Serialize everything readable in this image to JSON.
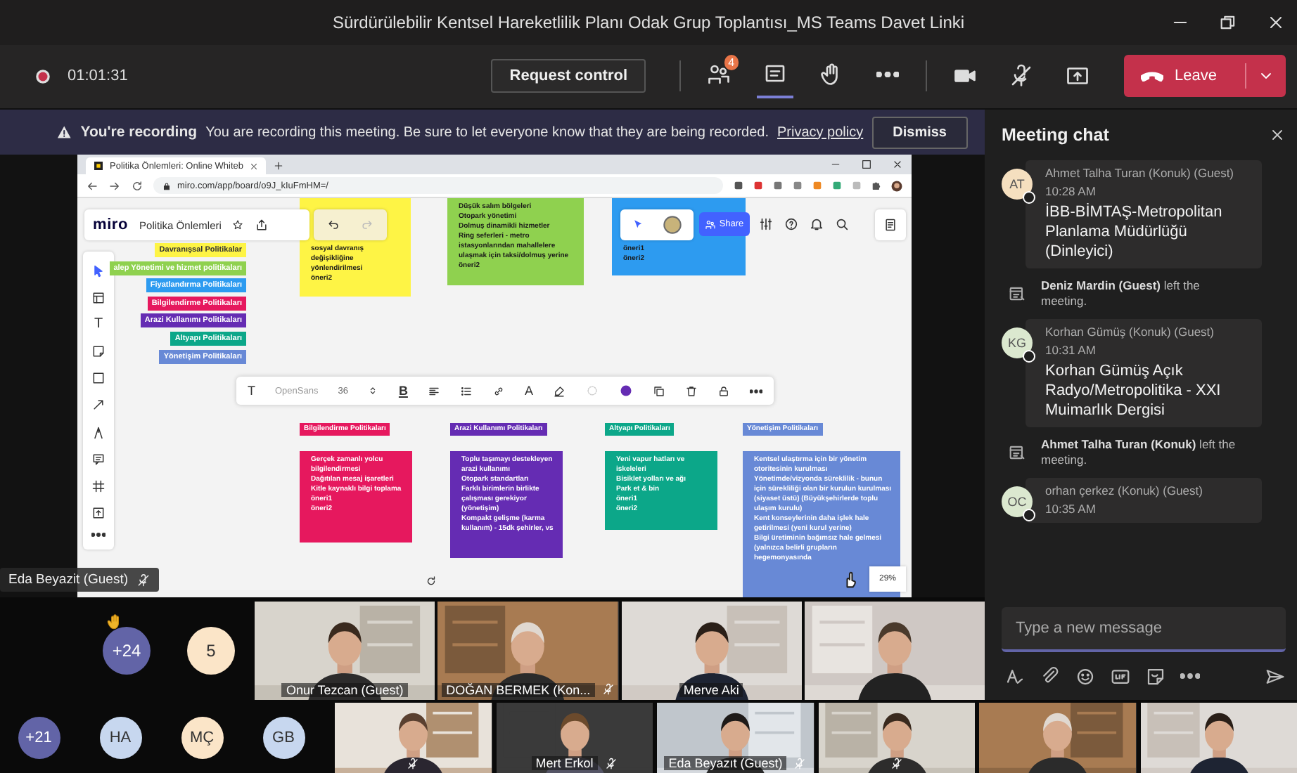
{
  "window": {
    "title": "Sürdürülebilir Kentsel Hareketlilik Planı Odak Grup Toplantısı_MS Teams Davet Linki"
  },
  "toolbar": {
    "timer": "01:01:31",
    "request_control": "Request control",
    "leave": "Leave",
    "actions": [
      {
        "kind": "participants",
        "badge": "4",
        "selected": false
      },
      {
        "kind": "chat",
        "selected": true
      },
      {
        "kind": "hand",
        "selected": false
      },
      {
        "kind": "more",
        "selected": false
      }
    ],
    "devices": [
      {
        "kind": "camera"
      },
      {
        "kind": "mic-off"
      },
      {
        "kind": "share"
      }
    ]
  },
  "banner": {
    "heading": "You're recording",
    "message": "You are recording this meeting. Be sure to let everyone know that they are being recorded.",
    "link": "Privacy policy",
    "dismiss": "Dismiss"
  },
  "shared_screen": {
    "presenter": "Eda Beyazit (Guest)",
    "browser": {
      "tab": "Politika Önlemleri: Online Whiteb",
      "url": "miro.com/app/board/o9J_kIuFmHM=/"
    },
    "board": {
      "logo": "miro",
      "title": "Politika Önlemleri",
      "share": "Share",
      "text_tool": "T",
      "zoom": "29%",
      "text_toolbar": {
        "text_tool": "T",
        "font": "OpenSans",
        "size": "36",
        "bold": "B",
        "color_tool": "A"
      },
      "legend": [
        {
          "label": "Davranışsal Politikalar",
          "color": "#fef445"
        },
        {
          "label": "alep Yönetimi ve hizmet politikaları",
          "color": "#8fd14f"
        },
        {
          "label": "Fiyatlandırma Politikaları",
          "color": "#2d9bf0"
        },
        {
          "label": "Bilgilendirme Politikaları",
          "color": "#e6185e"
        },
        {
          "label": "Arazi Kullanımı Politikaları",
          "color": "#652cb3"
        },
        {
          "label": "Altyapı Politikaları",
          "color": "#0ca789"
        },
        {
          "label": "Yönetişim Politikaları",
          "color": "#6889d6"
        }
      ],
      "stickies": [
        {
          "color": "#fef445",
          "items": [
            "sosyal davranış değişikliğine yönlendirilmesi",
            "öneri2"
          ]
        },
        {
          "color": "#8fd14f",
          "items": [
            "Düşük salım bölgeleri",
            "Otopark yönetimi",
            "Dolmuş dinamikli hizmetler",
            "Ring seferleri - metro istasyonlarından mahallelere ulaşmak için taksi/dolmuş yerine",
            "öneri2"
          ]
        },
        {
          "color": "#2d9bf0",
          "items": [
            "öneri1",
            "öneri2"
          ]
        }
      ],
      "columns": [
        {
          "title": "Bilgilendirme Politikaları",
          "color": "#e6185e",
          "items": [
            "Gerçek zamanlı yolcu bilgilendirmesi",
            "Dağıtılan mesaj işaretleri",
            "Kitle kaynaklı bilgi toplama",
            "öneri1",
            "öneri2"
          ]
        },
        {
          "title": "Arazi Kullanımı Politikaları",
          "color": "#652cb3",
          "items": [
            "Toplu taşımayı destekleyen arazi kullanımı",
            "Otopark standartları",
            "Farklı birimlerin birlikte çalışması gerekiyor (yönetişim)",
            "Kompakt gelişme (karma kullanım) - 15dk şehirler, vs"
          ]
        },
        {
          "title": "Altyapı Politikaları",
          "color": "#0ca789",
          "items": [
            "Yeni vapur hatları ve iskeleleri",
            "Bisiklet yolları ve ağı",
            "Park et & bin",
            "öneri1",
            "öneri2"
          ]
        },
        {
          "title": "Yönetişim Politikaları",
          "color": "#6889d6",
          "items": [
            "Kentsel ulaştırma için bir yönetim otoritesinin kurulması",
            "Yönetimde/vizyonda süreklilik - bunun için sürekliliği olan bir kurulun kurulması (siyaset üstü) (Büyükşehirlerde toplu ulaşım kurulu)",
            "Kent konseylerinin daha işlek hale getirilmesi (yeni kurul yerine)",
            "Bilgi üretiminin bağımsız hale gelmesi (yalnızca belirli grupların hegemonyasında"
          ]
        }
      ]
    }
  },
  "video_row": [
    {
      "kind": "avatar",
      "label": "+24",
      "color": "#6264a7",
      "hand": true
    },
    {
      "kind": "avatar",
      "label": "5",
      "color": "#fbe5c8",
      "hand": false
    },
    {
      "kind": "video",
      "name": "Onur Tezcan (Guest)",
      "muted": false
    },
    {
      "kind": "video",
      "name": "DOĞAN BERMEK (Kon...",
      "muted": true
    },
    {
      "kind": "video",
      "name": "Merve Aki",
      "muted": false
    },
    {
      "kind": "video",
      "muted": false
    }
  ],
  "bottom_row": [
    {
      "kind": "avatar",
      "label": "+21",
      "color": "#6264a7",
      "hand": false
    },
    {
      "kind": "avatar",
      "label": "HA",
      "color": "#c7d7ef",
      "hand": false
    },
    {
      "kind": "avatar",
      "label": "MÇ",
      "color": "#fbe5c8",
      "hand": false
    },
    {
      "kind": "avatar",
      "label": "GB",
      "color": "#c7d7ef",
      "hand": false
    },
    {
      "kind": "video",
      "muted": true
    },
    {
      "kind": "video",
      "name": "Mert Erkol",
      "muted": true
    },
    {
      "kind": "video",
      "name": "Eda Beyazıt (Guest)",
      "muted": true
    },
    {
      "kind": "video",
      "muted": true
    },
    {
      "kind": "video",
      "muted": false
    },
    {
      "kind": "video",
      "muted": false
    }
  ],
  "chat": {
    "title": "Meeting chat",
    "placeholder": "Type a new message",
    "messages": [
      {
        "kind": "message",
        "initials": "AT",
        "color": "#f5dfbf",
        "sender": "Ahmet Talha Turan (Konuk) (Guest)",
        "time": "10:28 AM",
        "text": "İBB-BİMTAŞ-Metropolitan Planlama Müdürlüğü (Dinleyici)"
      },
      {
        "kind": "event",
        "text": "**Deniz Mardin (Guest)** left the meeting."
      },
      {
        "kind": "message",
        "initials": "KG",
        "color": "#dbe8cf",
        "sender": "Korhan Gümüş (Konuk) (Guest)",
        "time": "10:31 AM",
        "text": "Korhan Gümüş Açık Radyo/Metropolitika - XXI Muimarlık Dergisi"
      },
      {
        "kind": "event",
        "text": "**Ahmet Talha Turan (Konuk)** left the meeting."
      },
      {
        "kind": "message",
        "initials": "OC",
        "color": "#dbe8cf",
        "sender": "orhan çerkez (Konuk) (Guest)",
        "time": "10:35 AM"
      }
    ]
  }
}
